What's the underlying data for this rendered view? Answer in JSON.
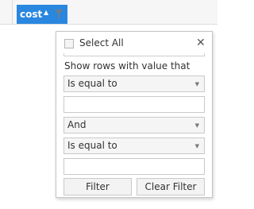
{
  "column_header": {
    "label": "cost",
    "sort_glyph": "▲",
    "sort_icon": "sort-ascending-icon",
    "filter_icon": "funnel-icon",
    "accent_color": "#2a87e0",
    "filter_icon_color": "#6b7f8f"
  },
  "filter_popup": {
    "select_all_label": "Select All",
    "close_glyph": "✕",
    "section_label": "Show rows with value that",
    "first_condition": "Is equal to",
    "first_value": "",
    "logical_operator": "And",
    "second_condition": "Is equal to",
    "second_value": "",
    "dropdown_caret": "▼",
    "filter_button_label": "Filter",
    "clear_filter_button_label": "Clear Filter"
  }
}
